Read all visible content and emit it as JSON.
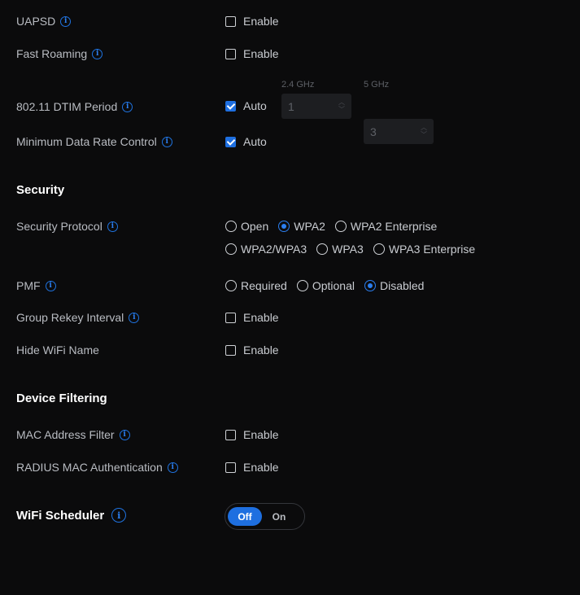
{
  "rows": {
    "uapsd": {
      "label": "UAPSD",
      "checkbox_label": "Enable",
      "checked": false
    },
    "fast_roaming": {
      "label": "Fast Roaming",
      "checkbox_label": "Enable",
      "checked": false
    },
    "dtim": {
      "label": "802.11 DTIM Period",
      "checkbox_label": "Auto",
      "checked": true,
      "band_24_label": "2.4 GHz",
      "band_24_value": "1",
      "band_5_label": "5 GHz",
      "band_5_value": "3"
    },
    "min_data_rate": {
      "label": "Minimum Data Rate Control",
      "checkbox_label": "Auto",
      "checked": true
    }
  },
  "security": {
    "title": "Security",
    "protocol_label": "Security Protocol",
    "protocol_options": [
      "Open",
      "WPA2",
      "WPA2 Enterprise",
      "WPA2/WPA3",
      "WPA3",
      "WPA3 Enterprise"
    ],
    "protocol_selected": "WPA2",
    "pmf_label": "PMF",
    "pmf_options": [
      "Required",
      "Optional",
      "Disabled"
    ],
    "pmf_selected": "Disabled",
    "group_rekey": {
      "label": "Group Rekey Interval",
      "checkbox_label": "Enable",
      "checked": false
    },
    "hide_wifi": {
      "label": "Hide WiFi Name",
      "checkbox_label": "Enable",
      "checked": false
    }
  },
  "device_filtering": {
    "title": "Device Filtering",
    "mac_filter": {
      "label": "MAC Address Filter",
      "checkbox_label": "Enable",
      "checked": false
    },
    "radius_mac": {
      "label": "RADIUS MAC Authentication",
      "checkbox_label": "Enable",
      "checked": false
    }
  },
  "scheduler": {
    "title": "WiFi Scheduler",
    "off_label": "Off",
    "on_label": "On",
    "state": "Off"
  },
  "icons": {
    "info": "info-icon"
  },
  "colors": {
    "accent": "#1e6fe0",
    "background": "#0b0b0c"
  }
}
